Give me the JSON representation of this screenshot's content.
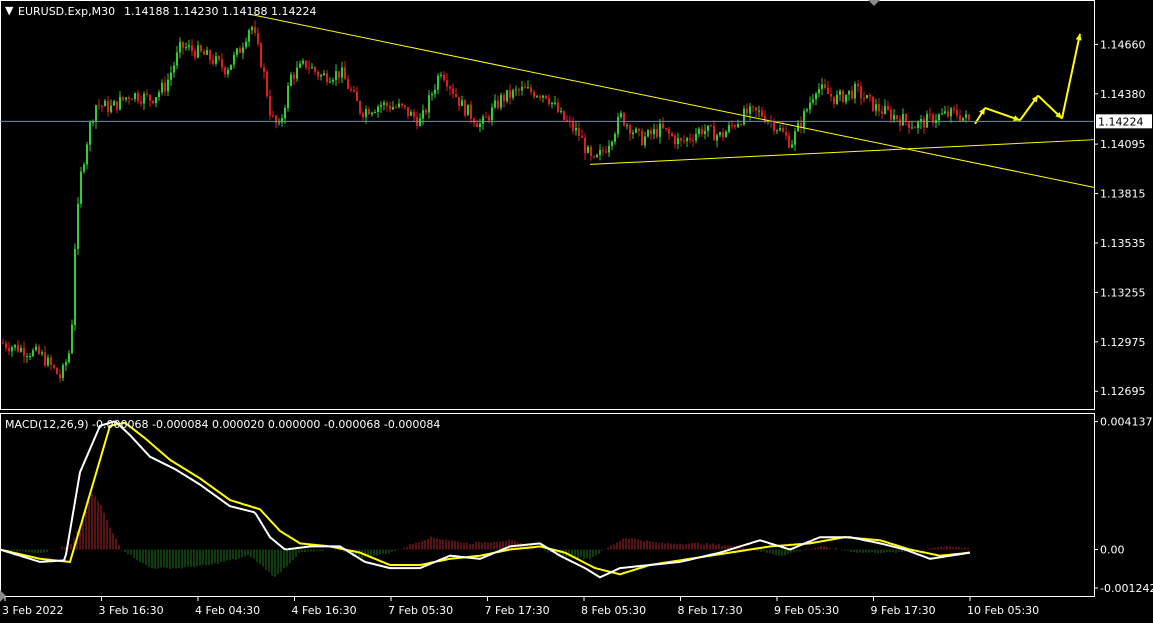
{
  "header": {
    "menu_arrow": "▼",
    "symbol": "EURUSD.Exp,M30",
    "ohlc": "1.14188 1.14230 1.14188 1.14224"
  },
  "macd_header": "MACD(12,26,9) -0.000068 -0.000084 0.000020 0.000000 -0.000068 -0.000084",
  "colors": {
    "background": "#000000",
    "bull": "#32cd32",
    "bear": "#dc1e1e",
    "trendline": "#ffff00",
    "macd_line": "#ffffff",
    "signal_line": "#ffff00",
    "hist_pos": "#b22222",
    "hist_neg": "#1a7a1a",
    "bid_line": "#6f8faf",
    "grid_border": "#ffffff"
  },
  "chart_data": [
    {
      "type": "candlestick",
      "symbol": "EURUSD.Exp",
      "timeframe": "M30",
      "ylim": [
        1.126,
        1.149
      ],
      "y_ticks": [
        "1.14660",
        "1.14380",
        "1.14095",
        "1.13815",
        "1.13535",
        "1.13255",
        "1.12975",
        "1.12695"
      ],
      "current_price": "1.14224",
      "x_ticks": [
        "3 Feb 2022",
        "3 Feb 16:30",
        "4 Feb 04:30",
        "4 Feb 16:30",
        "7 Feb 05:30",
        "7 Feb 17:30",
        "8 Feb 05:30",
        "8 Feb 17:30",
        "9 Feb 05:30",
        "9 Feb 17:30",
        "10 Feb 05:30"
      ],
      "close_path": [
        [
          0,
          1.1297
        ],
        [
          40,
          1.129
        ],
        [
          60,
          1.1277
        ],
        [
          70,
          1.1295
        ],
        [
          74,
          1.1352
        ],
        [
          80,
          1.1392
        ],
        [
          88,
          1.1418
        ],
        [
          95,
          1.1432
        ],
        [
          110,
          1.143
        ],
        [
          130,
          1.1438
        ],
        [
          150,
          1.1435
        ],
        [
          165,
          1.1443
        ],
        [
          180,
          1.1465
        ],
        [
          195,
          1.1462
        ],
        [
          210,
          1.1458
        ],
        [
          225,
          1.1452
        ],
        [
          238,
          1.1462
        ],
        [
          250,
          1.1478
        ],
        [
          262,
          1.1452
        ],
        [
          270,
          1.1425
        ],
        [
          278,
          1.1418
        ],
        [
          290,
          1.1448
        ],
        [
          305,
          1.1455
        ],
        [
          320,
          1.1448
        ],
        [
          340,
          1.145
        ],
        [
          360,
          1.1428
        ],
        [
          380,
          1.1432
        ],
        [
          400,
          1.143
        ],
        [
          420,
          1.1422
        ],
        [
          440,
          1.1452
        ],
        [
          460,
          1.1432
        ],
        [
          480,
          1.142
        ],
        [
          500,
          1.1435
        ],
        [
          520,
          1.144
        ],
        [
          545,
          1.1438
        ],
        [
          560,
          1.1425
        ],
        [
          578,
          1.1415
        ],
        [
          592,
          1.1398
        ],
        [
          605,
          1.1408
        ],
        [
          620,
          1.1425
        ],
        [
          640,
          1.1412
        ],
        [
          660,
          1.1418
        ],
        [
          680,
          1.141
        ],
        [
          700,
          1.1418
        ],
        [
          720,
          1.1414
        ],
        [
          745,
          1.1427
        ],
        [
          760,
          1.1427
        ],
        [
          775,
          1.142
        ],
        [
          790,
          1.141
        ],
        [
          805,
          1.1428
        ],
        [
          815,
          1.1442
        ],
        [
          835,
          1.1435
        ],
        [
          855,
          1.144
        ],
        [
          875,
          1.143
        ],
        [
          895,
          1.1425
        ],
        [
          915,
          1.142
        ],
        [
          935,
          1.1425
        ],
        [
          955,
          1.1427
        ],
        [
          970,
          1.1422
        ]
      ],
      "trendlines": [
        {
          "from": [
            "4 Feb 04:30",
            1.1483
          ],
          "to": [
            "10 Feb 05:30",
            1.1385
          ]
        },
        {
          "from": [
            "8 Feb 05:30",
            1.1398
          ],
          "to": [
            "10 Feb 05:30",
            1.1412
          ]
        }
      ],
      "forecast_arrows": [
        [
          975,
          1.1421
        ],
        [
          985,
          1.143
        ],
        [
          1020,
          1.1423
        ],
        [
          1038,
          1.1437
        ],
        [
          1062,
          1.1424
        ],
        [
          1080,
          1.1472
        ]
      ]
    },
    {
      "type": "macd",
      "params": "12,26,9",
      "y_ticks": [
        "0.004137",
        "0.00",
        "-0.001242"
      ],
      "ylim": [
        -0.00147,
        0.00435
      ],
      "macd_path": [
        [
          0,
          0.0
        ],
        [
          40,
          -0.0004
        ],
        [
          65,
          -0.00035
        ],
        [
          80,
          0.0025
        ],
        [
          100,
          0.004
        ],
        [
          115,
          0.00415
        ],
        [
          130,
          0.0037
        ],
        [
          150,
          0.003
        ],
        [
          175,
          0.0026
        ],
        [
          200,
          0.0021
        ],
        [
          230,
          0.0014
        ],
        [
          255,
          0.0012
        ],
        [
          270,
          0.0004
        ],
        [
          285,
          0.0
        ],
        [
          310,
          0.0001
        ],
        [
          340,
          0.0001
        ],
        [
          365,
          -0.0004
        ],
        [
          390,
          -0.0006
        ],
        [
          420,
          -0.0006
        ],
        [
          450,
          -0.0002
        ],
        [
          480,
          -0.0003
        ],
        [
          510,
          0.0001
        ],
        [
          540,
          0.0002
        ],
        [
          560,
          -0.0002
        ],
        [
          585,
          -0.0006
        ],
        [
          600,
          -0.0009
        ],
        [
          620,
          -0.0006
        ],
        [
          650,
          -0.0005
        ],
        [
          680,
          -0.0004
        ],
        [
          720,
          -0.0001
        ],
        [
          760,
          0.0003
        ],
        [
          790,
          0.0
        ],
        [
          820,
          0.0004
        ],
        [
          850,
          0.0004
        ],
        [
          880,
          0.0002
        ],
        [
          905,
          0.0
        ],
        [
          930,
          -0.0003
        ],
        [
          970,
          -0.0001
        ]
      ],
      "signal_path": [
        [
          0,
          0.0
        ],
        [
          40,
          -0.0003
        ],
        [
          70,
          -0.0004
        ],
        [
          90,
          0.0018
        ],
        [
          110,
          0.004
        ],
        [
          125,
          0.0041
        ],
        [
          145,
          0.0036
        ],
        [
          170,
          0.0029
        ],
        [
          200,
          0.0023
        ],
        [
          230,
          0.0016
        ],
        [
          260,
          0.0013
        ],
        [
          280,
          0.0006
        ],
        [
          300,
          0.0002
        ],
        [
          330,
          0.0001
        ],
        [
          360,
          -0.0001
        ],
        [
          390,
          -0.0005
        ],
        [
          420,
          -0.0005
        ],
        [
          450,
          -0.0003
        ],
        [
          480,
          -0.0002
        ],
        [
          510,
          0.0
        ],
        [
          540,
          0.0001
        ],
        [
          565,
          -0.0001
        ],
        [
          595,
          -0.0006
        ],
        [
          620,
          -0.0008
        ],
        [
          650,
          -0.0005
        ],
        [
          690,
          -0.0003
        ],
        [
          730,
          -0.0001
        ],
        [
          770,
          0.0001
        ],
        [
          810,
          0.0002
        ],
        [
          845,
          0.0004
        ],
        [
          880,
          0.0003
        ],
        [
          910,
          0.0
        ],
        [
          940,
          -0.0002
        ],
        [
          970,
          -0.0001
        ]
      ],
      "hist_path": [
        [
          0,
          0.0
        ],
        [
          40,
          -0.0001
        ],
        [
          70,
          0.0001
        ],
        [
          82,
          0.0009
        ],
        [
          92,
          0.0018
        ],
        [
          100,
          0.0015
        ],
        [
          110,
          0.0007
        ],
        [
          122,
          0.0
        ],
        [
          150,
          -0.0006
        ],
        [
          180,
          -0.0006
        ],
        [
          210,
          -0.0005
        ],
        [
          250,
          -0.0002
        ],
        [
          275,
          -0.0009
        ],
        [
          300,
          -0.0001
        ],
        [
          340,
          0.0
        ],
        [
          360,
          -0.0003
        ],
        [
          390,
          -0.0001
        ],
        [
          430,
          0.0004
        ],
        [
          470,
          0.0002
        ],
        [
          510,
          0.0003
        ],
        [
          560,
          -0.0002
        ],
        [
          590,
          -0.0003
        ],
        [
          625,
          0.0004
        ],
        [
          660,
          0.0002
        ],
        [
          700,
          0.0002
        ],
        [
          740,
          0.0001
        ],
        [
          780,
          -0.0002
        ],
        [
          820,
          0.0001
        ],
        [
          860,
          -0.0001
        ],
        [
          900,
          -0.0001
        ],
        [
          940,
          0.0001
        ],
        [
          970,
          5e-05
        ]
      ]
    }
  ]
}
